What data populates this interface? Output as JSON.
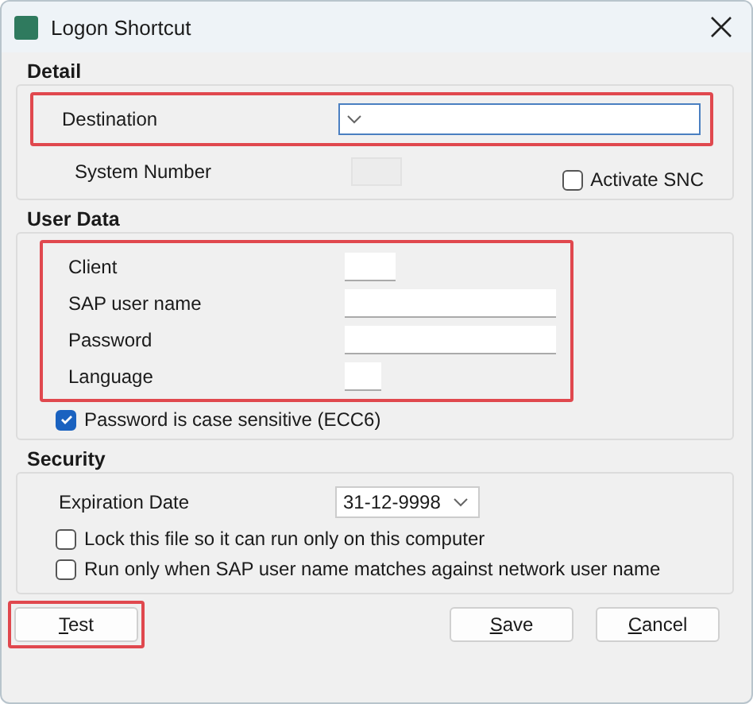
{
  "window": {
    "title": "Logon Shortcut"
  },
  "detail": {
    "title": "Detail",
    "destination": {
      "label": "Destination",
      "highlighted": true
    },
    "system_number": {
      "label": "System Number",
      "disabled": true
    },
    "activate_snc": {
      "label": "Activate SNC",
      "checked": false
    }
  },
  "user_data": {
    "title": "User Data",
    "highlighted": true,
    "fields": [
      {
        "label": "Client"
      },
      {
        "label": "SAP user name"
      },
      {
        "label": "Password"
      },
      {
        "label": "Language"
      }
    ],
    "case_sensitive": {
      "label": "Password is case sensitive (ECC6)",
      "checked": true
    }
  },
  "security": {
    "title": "Security",
    "expiration": {
      "label": "Expiration Date",
      "value": "31-12-9998"
    },
    "options": [
      {
        "label": "Lock this file so it can run only on this computer",
        "checked": false
      },
      {
        "label": "Run only when SAP user name matches against network user name",
        "checked": false
      }
    ]
  },
  "buttons": [
    {
      "label": "Test",
      "highlighted": true,
      "kind": "left"
    },
    {
      "label": "Save",
      "highlighted": false,
      "kind": "right"
    },
    {
      "label": "Cancel",
      "highlighted": false,
      "kind": "right"
    }
  ]
}
